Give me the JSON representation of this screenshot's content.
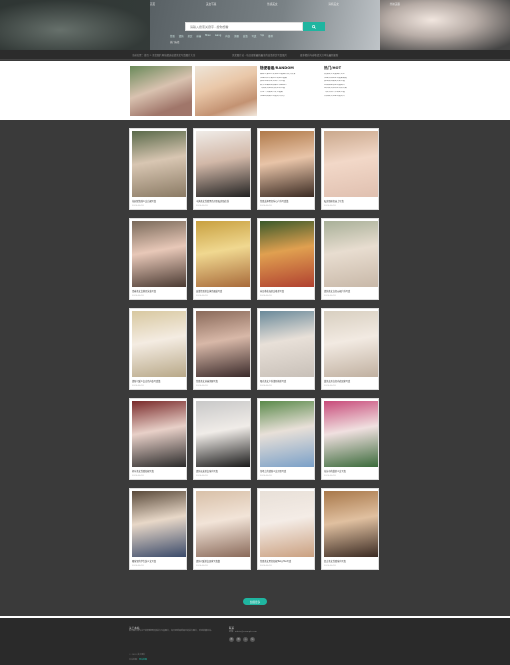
{
  "nav": {
    "items": [
      "首页",
      "美女写真",
      "性感美女",
      "清纯美女",
      "丝袜美腿"
    ]
  },
  "search": {
    "placeholder": "请输入搜索关键字...搜你想看",
    "button_icon": "search-icon"
  },
  "hot_tags": [
    "性感",
    "清纯",
    "美女",
    "丝袜",
    "Mian",
    "wang",
    "内衣",
    "美腿",
    "高清",
    "写真",
    "Vip",
    "推荐"
  ],
  "hot_label": "热门标签",
  "notice": {
    "left": "当前位置：首页 > 美女图片网站精选高清美女写真图片大全",
    "middle": "美女图片站 - 每日更新最新最全的高清美女写真图片",
    "right": "更多精彩内容敬请关注本站最新更新"
  },
  "featured": {
    "random_title": "随便看看/RANDOM",
    "hot_title": "热门/HOT",
    "random_list": [
      "湘妹子清纯可爱私房写真图片欣赏高清",
      "性感尤物丰满身材诱惑写真集",
      "清新淡雅邻家女孩户外写真",
      "美女主播私房照曝光性感迷人",
      "气质美女街拍时尚穿搭写真",
      "日系少女甜美可爱写真集",
      "性感内衣模特写真大片欣赏"
    ],
    "hot_list": [
      "高清美女写真图片大全",
      "性感女神私房写真集精选",
      "清纯校花甜美笑容写真",
      "丝袜美腿诱惑写真图片",
      "网红美女自拍生活照合集",
      "气质女神户外唯美写真",
      "日韩美女性感写真大片"
    ]
  },
  "cards": [
    {
      "caption": "花园里清纯少女白裙写真",
      "meta": "2020-06-18",
      "c1": "#5a6a4a",
      "c2": "#d8c6b2",
      "c3": "#8a7a64"
    },
    {
      "caption": "丰满美女性感黑色吊带私房照在线",
      "meta": "2020-06-18",
      "c1": "#f0ece8",
      "c2": "#d2b8a8",
      "c3": "#222222"
    },
    {
      "caption": "性感女神黑色背心户外写真集",
      "meta": "2020-06-18",
      "c1": "#b07a4a",
      "c2": "#e8c4a8",
      "c3": "#3a2a22"
    },
    {
      "caption": "私房照粉色床上写真",
      "meta": "2020-06-18",
      "c1": "#caa88c",
      "c2": "#f2d8c8",
      "c3": "#e0c0b0"
    },
    {
      "caption": "青春美女比基尼泳装写真",
      "meta": "2020-06-18",
      "c1": "#7a6a5a",
      "c2": "#e8c8b8",
      "c3": "#4a3a32"
    },
    {
      "caption": "高清性感美女黄色服装写真",
      "meta": "2020-06-18",
      "c1": "#c8a040",
      "c2": "#f0d890",
      "c3": "#a86a3a"
    },
    {
      "caption": "向日葵花海美女唯美写真",
      "meta": "2020-06-18",
      "c1": "#3a5a2a",
      "c2": "#e0a050",
      "c3": "#b04030"
    },
    {
      "caption": "清纯美女白色纱裙户外写真",
      "meta": "2020-06-18",
      "c1": "#a8b098",
      "c2": "#e8ddd0",
      "c3": "#c8b8a8"
    },
    {
      "caption": "清新可爱少女白色内衣写真集",
      "meta": "2020-06-18",
      "c1": "#d8c8a0",
      "c2": "#f4ece2",
      "c3": "#b8a888"
    },
    {
      "caption": "性感美女丝袜美腿写真",
      "meta": "2020-06-18",
      "c1": "#8a6a5a",
      "c2": "#d8b8a8",
      "c3": "#3a2a2a"
    },
    {
      "caption": "阳光美女户外清新唯美写真",
      "meta": "2020-06-18",
      "c1": "#6a8a9a",
      "c2": "#e8e0d8",
      "c3": "#c8c0b8"
    },
    {
      "caption": "甜美女孩白色内衣居家写真",
      "meta": "2020-06-18",
      "c1": "#d8cfc0",
      "c2": "#f2eae2",
      "c3": "#c0b0a0"
    },
    {
      "caption": "机车美女性感短裙写真",
      "meta": "2020-06-18",
      "c1": "#7a2a2a",
      "c2": "#e8d0c8",
      "c3": "#2a2a2a"
    },
    {
      "caption": "清纯长发美女室内写真",
      "meta": "2020-06-18",
      "c1": "#c8c8c8",
      "c2": "#f0ece8",
      "c3": "#1a1a1a"
    },
    {
      "caption": "草地上的清纯少女吊带写真",
      "meta": "2020-06-18",
      "c1": "#5a8a4a",
      "c2": "#e8e0d8",
      "c3": "#7aa0c8"
    },
    {
      "caption": "花丛中的甜美少女写真",
      "meta": "2020-06-18",
      "c1": "#c84a7a",
      "c2": "#f0e0e0",
      "c3": "#3a6a3a"
    },
    {
      "caption": "教室里的学生装少女写真",
      "meta": "2020-06-18",
      "c1": "#5a4a3a",
      "c2": "#e8d8c8",
      "c3": "#3a4a6a"
    },
    {
      "caption": "清纯可爱美女居家写真集",
      "meta": "2020-06-18",
      "c1": "#d8c0a8",
      "c2": "#f2e4d8",
      "c3": "#8a6a5a"
    },
    {
      "caption": "性感美女黑色短裙Teng Tsu写真",
      "meta": "2020-06-18",
      "c1": "#e8e0d8",
      "c2": "#f4ece6",
      "c3": "#caa080"
    },
    {
      "caption": "复古美女性感室内写真",
      "meta": "2020-06-18",
      "c1": "#a8784a",
      "c2": "#e0c0a0",
      "c3": "#3a2a22"
    }
  ],
  "more_button": "加载更多",
  "footer": {
    "about_title": "关于本站",
    "about_text": "美女图片站专注于收集整理高清美女写真图片，每日更新最新最全的美女图片，欢迎收藏本站。",
    "contact_title": "联系",
    "contact_text": "邮箱：admin@example.com",
    "social": [
      "微",
      "博",
      "Q",
      "信"
    ],
    "copy": "© 2020 美女图片",
    "sitemap_prefix": "本站地图：",
    "sitemap_link": "网站地图"
  }
}
